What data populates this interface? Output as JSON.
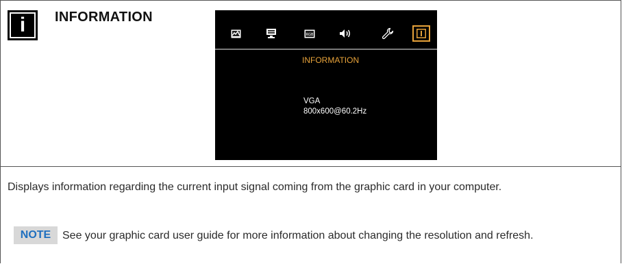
{
  "header": {
    "badge_icon": "information-icon",
    "title": "INFORMATION"
  },
  "osd": {
    "tabs": [
      {
        "icon": "picture-icon",
        "active": false
      },
      {
        "icon": "monitor-adjust-icon",
        "active": false
      },
      {
        "icon": "rgb-color-icon",
        "active": false
      },
      {
        "icon": "speaker-icon",
        "active": false
      },
      {
        "icon": "wrench-icon",
        "active": false
      },
      {
        "icon": "information-icon",
        "active": true
      }
    ],
    "heading": "INFORMATION",
    "source": "VGA",
    "mode": "800x600@60.2Hz",
    "colors": {
      "background": "#000000",
      "accent": "#e8a33a",
      "text": "#ffffff",
      "divider": "#7a7a7a"
    }
  },
  "description": "Displays information regarding the current input signal coming from the graphic card in your computer.",
  "note": {
    "label": "NOTE",
    "text": "See your graphic card user guide for more information about changing the resolution and refresh.",
    "label_color": "#1e6fbf"
  }
}
